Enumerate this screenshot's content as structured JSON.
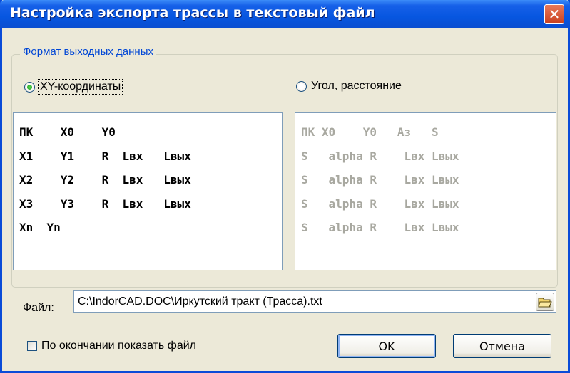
{
  "window": {
    "title": "Настройка экспорта трассы в текстовый файл",
    "close_glyph": "✕"
  },
  "group": {
    "legend": "Формат выходных данных",
    "options": [
      {
        "label": "XY-координаты",
        "selected": true
      },
      {
        "label": "Угол, расстояние",
        "selected": false
      }
    ]
  },
  "preview_xy": [
    "ПК    X0    Y0",
    "X1    Y1    R  Lвх   Lвых",
    "X2    Y2    R  Lвх   Lвых",
    "X3    Y3    R  Lвх   Lвых",
    "Xn  Yn"
  ],
  "preview_angle": [
    "ПК X0    Y0   Aз   S",
    "S   alpha R    Lвх Lвых",
    "S   alpha R    Lвх Lвых",
    "S   alpha R    Lвх Lвых",
    "S   alpha R    Lвх Lвых"
  ],
  "file": {
    "label": "Файл:",
    "path": "C:\\IndorCAD.DOC\\Иркутский тракт (Трасса).txt",
    "browse_icon": "folder-open-icon"
  },
  "show_file_checkbox": {
    "label": "По окончании показать файл",
    "checked": false
  },
  "buttons": {
    "ok": "OK",
    "cancel": "Отмена"
  }
}
